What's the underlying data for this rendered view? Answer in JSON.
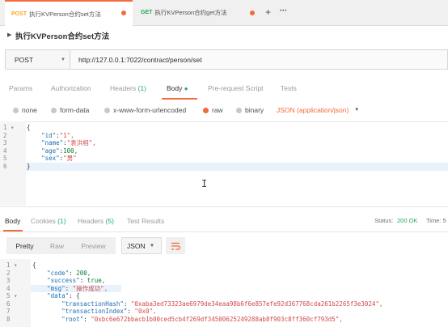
{
  "tabs": [
    {
      "method": "POST",
      "title": "执行KVPerson合约set方法"
    },
    {
      "method": "GET",
      "title": "执行KVPerson合约get方法"
    }
  ],
  "tab_actions": {
    "add": "+",
    "more": "•••"
  },
  "request_name": "执行KVPerson合约set方法",
  "method": "POST",
  "url": "http://127.0.0.1:7022/contract/person/set",
  "req_tabs": [
    "Params",
    "Authorization",
    "Headers",
    "(1)",
    "Body",
    "Pre-request Script",
    "Tests"
  ],
  "body_types": [
    "none",
    "form-data",
    "x-www-form-urlencoded",
    "raw",
    "binary"
  ],
  "content_type": "JSON (application/json)",
  "request_lines": [
    {
      "n": "1",
      "t": "{"
    },
    {
      "n": "2",
      "k": "\"id\"",
      "v": "\"1\","
    },
    {
      "n": "3",
      "k": "\"name\"",
      "v": "\"袁洪相\","
    },
    {
      "n": "4",
      "k": "\"age\"",
      "v": "100,"
    },
    {
      "n": "5",
      "k": "\"sex\"",
      "v": "\"男\""
    },
    {
      "n": "6",
      "t": "}"
    }
  ],
  "resp_tabs": {
    "body": "Body",
    "cookies": "Cookies",
    "cookies_count": "(1)",
    "headers": "Headers",
    "headers_count": "(5)",
    "tests": "Test Results"
  },
  "status": {
    "label": "Status:",
    "value": "200 OK",
    "time": "Time: 5"
  },
  "view_buttons": [
    "Pretty",
    "Raw",
    "Preview",
    "JSON"
  ],
  "response_lines": [
    {
      "n": "1",
      "t": "{"
    },
    {
      "n": "2",
      "k": "\"code\"",
      "v": " 200,"
    },
    {
      "n": "3",
      "k": "\"success\"",
      "v": " true,"
    },
    {
      "n": "4",
      "k": "\"msg\"",
      "v": " \"操作成功\","
    },
    {
      "n": "5",
      "k": "\"data\"",
      "v": " {"
    },
    {
      "n": "6",
      "k": "\"transactionHash\"",
      "v": " \"0xaba3ed73323ae6979de34eaa98b6f6e857efe92d367768cda261b2265f3e3024\","
    },
    {
      "n": "7",
      "k": "\"transactionIndex\"",
      "v": " \"0x0\","
    },
    {
      "n": "8",
      "k": "\"root\"",
      "v": " \"0xbc6e672bbacb1b00ced5cb4f269df34500625249288ab8f903c8ff360cf793d5\","
    }
  ],
  "colors": {
    "accent": "#f26b3a",
    "post": "#f5a623",
    "get": "#26a862"
  }
}
